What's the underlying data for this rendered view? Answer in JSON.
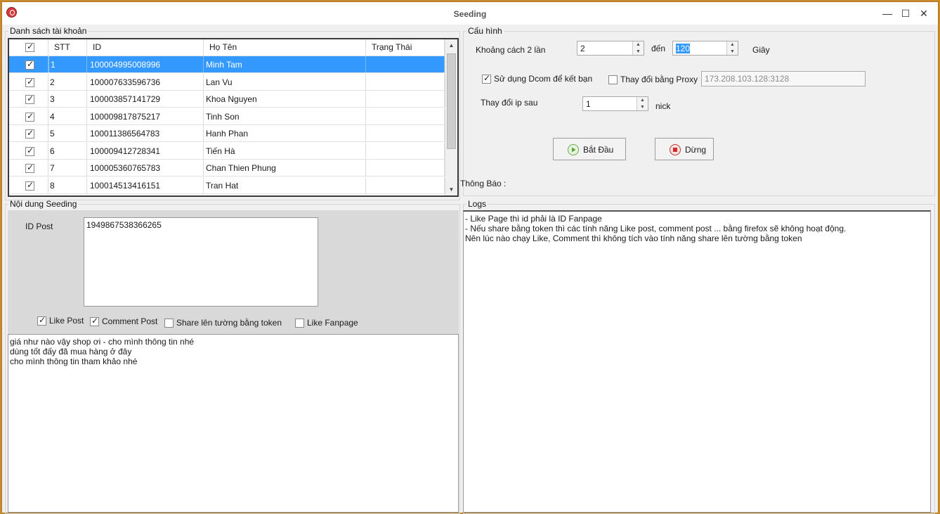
{
  "window": {
    "title": "Seeding",
    "controls": {
      "minimize": "—",
      "maximize": "☐",
      "close": "✕"
    }
  },
  "accounts": {
    "legend": "Danh sách tài khoản",
    "columns": {
      "stt": "STT",
      "id": "ID",
      "name": "Họ Tên",
      "status": "Trạng Thái"
    },
    "rows": [
      {
        "stt": "1",
        "id": "100004995008996",
        "name": "Minh Tam",
        "status": "",
        "checked": true
      },
      {
        "stt": "2",
        "id": "100007633596736",
        "name": "Lan Vu",
        "status": "",
        "checked": true
      },
      {
        "stt": "3",
        "id": "100003857141729",
        "name": "Khoa Nguyen",
        "status": "",
        "checked": true
      },
      {
        "stt": "4",
        "id": "100009817875217",
        "name": "Tinh Son",
        "status": "",
        "checked": true
      },
      {
        "stt": "5",
        "id": "100011386564783",
        "name": "Hanh Phan",
        "status": "",
        "checked": true
      },
      {
        "stt": "6",
        "id": "100009412728341",
        "name": "Tiến Hà",
        "status": "",
        "checked": true
      },
      {
        "stt": "7",
        "id": "100005360765783",
        "name": "Chan Thien Phung",
        "status": "",
        "checked": true
      },
      {
        "stt": "8",
        "id": "100014513416151",
        "name": "Tran Hat",
        "status": "",
        "checked": true
      }
    ]
  },
  "config": {
    "legend": "Cấu hình",
    "interval_label": "Khoảng cách 2 lần",
    "interval_from": "2",
    "to_label": "đến",
    "interval_to": "120",
    "unit_label": "Giây",
    "dcom_label": "Sử dụng Dcom để kết bạn",
    "proxy_label": "Thay đổi bằng Proxy",
    "proxy_value": "173.208.103.128:3128",
    "change_ip_label": "Thay đổi ip sau",
    "change_ip_value": "1",
    "nick_label": "nick",
    "start_label": "Bắt Đầu",
    "stop_label": "Dừng",
    "notice_label": "Thông Báo :"
  },
  "seeding": {
    "legend": "Nội dung Seeding",
    "id_post_label": "ID Post",
    "id_post_value": "1949867538366265",
    "options": {
      "like_post": "Like Post",
      "comment_post": "Comment Post",
      "share_label": "Share lên tường bằng token",
      "like_fanpage": "Like Fanpage"
    },
    "comments": [
      "giá như nào vậy shop ơi - cho mình thông tin nhé",
      "dùng tốt đấy đã mua hàng ở đây",
      "cho mình thông tin tham khảo nhé"
    ]
  },
  "logs": {
    "legend": "Logs",
    "lines": [
      "- Like Page thì id phải là ID Fanpage",
      "- Nếu share bằng token thì các tính năng Like post, comment post ... bằng firefox sẽ không hoạt động.",
      "Nên lúc nào chạy Like, Comment thì không tích vào tính năng share lên tường bằng token"
    ]
  },
  "colors": {
    "selection": "#3399ff",
    "frame": "#c98a2e"
  }
}
